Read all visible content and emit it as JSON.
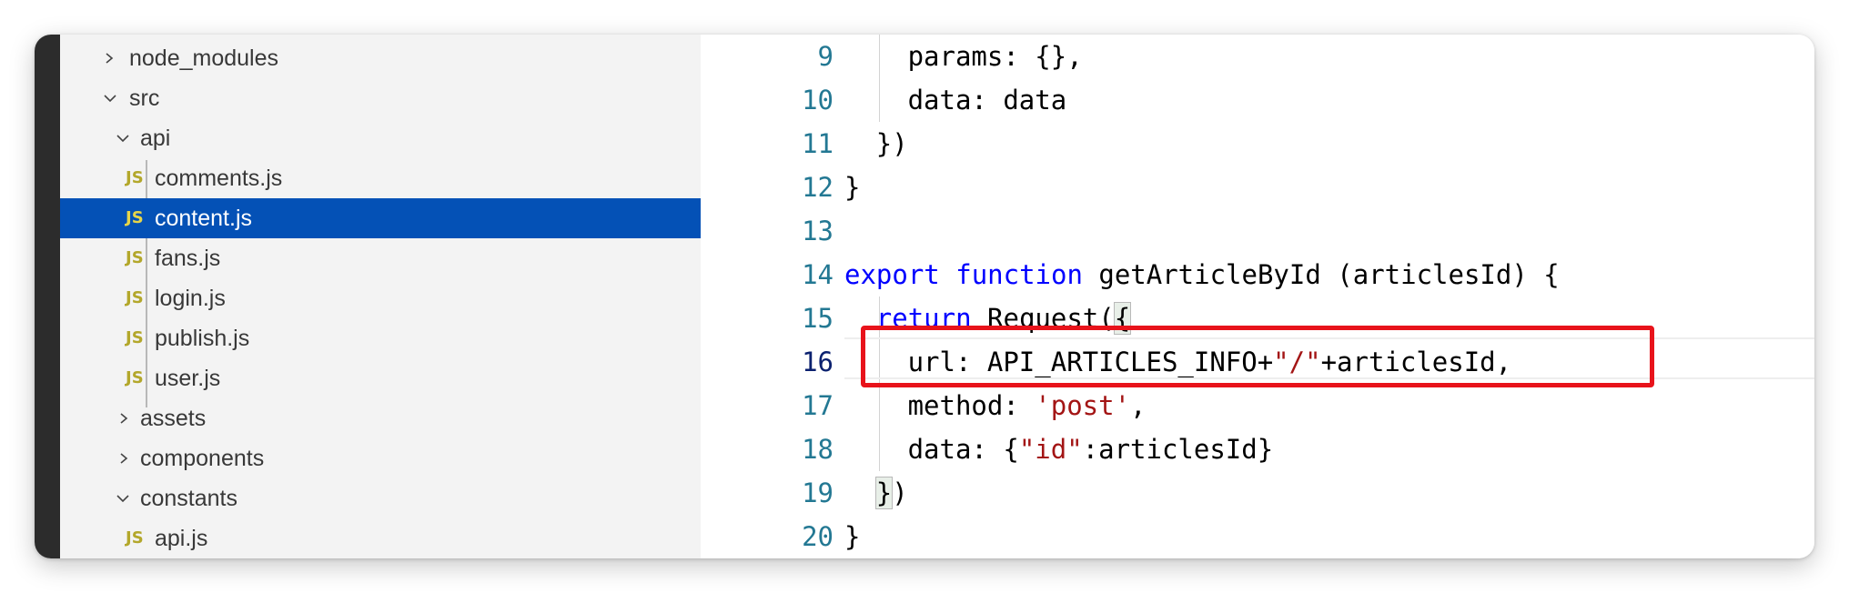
{
  "explorer": {
    "items": [
      {
        "label": "node_modules",
        "type": "folder",
        "state": "collapsed"
      },
      {
        "label": "src",
        "type": "folder",
        "state": "expanded"
      },
      {
        "label": "api",
        "type": "folder",
        "state": "expanded"
      },
      {
        "label": "comments.js",
        "type": "file",
        "badge": "JS"
      },
      {
        "label": "content.js",
        "type": "file",
        "badge": "JS",
        "selected": true
      },
      {
        "label": "fans.js",
        "type": "file",
        "badge": "JS"
      },
      {
        "label": "login.js",
        "type": "file",
        "badge": "JS"
      },
      {
        "label": "publish.js",
        "type": "file",
        "badge": "JS"
      },
      {
        "label": "user.js",
        "type": "file",
        "badge": "JS"
      },
      {
        "label": "assets",
        "type": "folder",
        "state": "collapsed"
      },
      {
        "label": "components",
        "type": "folder",
        "state": "collapsed"
      },
      {
        "label": "constants",
        "type": "folder",
        "state": "expanded"
      },
      {
        "label": "api.js",
        "type": "file",
        "badge": "JS"
      }
    ]
  },
  "editor": {
    "active_line": "16",
    "lines": [
      {
        "n": "9",
        "segments": [
          {
            "t": "params: {},",
            "c": "plain"
          }
        ]
      },
      {
        "n": "10",
        "segments": [
          {
            "t": "data: data",
            "c": "plain"
          }
        ]
      },
      {
        "n": "11",
        "segments": [
          {
            "t": "})",
            "c": "plain"
          }
        ]
      },
      {
        "n": "12",
        "segments": [
          {
            "t": "}",
            "c": "plain"
          }
        ]
      },
      {
        "n": "13",
        "segments": []
      },
      {
        "n": "14",
        "segments": [
          {
            "t": "export",
            "c": "kw"
          },
          {
            "t": " ",
            "c": "plain"
          },
          {
            "t": "function",
            "c": "kw"
          },
          {
            "t": " getArticleById (articlesId) {",
            "c": "plain"
          }
        ]
      },
      {
        "n": "15",
        "segments": [
          {
            "t": "return",
            "c": "kw"
          },
          {
            "t": " Request(",
            "c": "plain"
          },
          {
            "t": "{",
            "c": "bracket"
          }
        ]
      },
      {
        "n": "16",
        "segments": [
          {
            "t": "url: API_ARTICLES_INFO+",
            "c": "plain"
          },
          {
            "t": "\"/\"",
            "c": "str"
          },
          {
            "t": "+articlesId,",
            "c": "plain"
          }
        ]
      },
      {
        "n": "17",
        "segments": [
          {
            "t": "method: ",
            "c": "plain"
          },
          {
            "t": "'post'",
            "c": "str"
          },
          {
            "t": ",",
            "c": "plain"
          }
        ]
      },
      {
        "n": "18",
        "segments": [
          {
            "t": "data: {",
            "c": "plain"
          },
          {
            "t": "\"id\"",
            "c": "str"
          },
          {
            "t": ":articlesId}",
            "c": "plain"
          }
        ]
      },
      {
        "n": "19",
        "segments": [
          {
            "t": "}",
            "c": "bracket"
          },
          {
            "t": ")",
            "c": "plain"
          }
        ]
      },
      {
        "n": "20",
        "segments": [
          {
            "t": "}",
            "c": "plain"
          }
        ]
      }
    ]
  },
  "annotation": {
    "color": "#e8131b"
  },
  "colors": {
    "selection": "#0451b6",
    "keyword": "#0000ff",
    "string": "#a31515",
    "line_number": "#237893"
  }
}
